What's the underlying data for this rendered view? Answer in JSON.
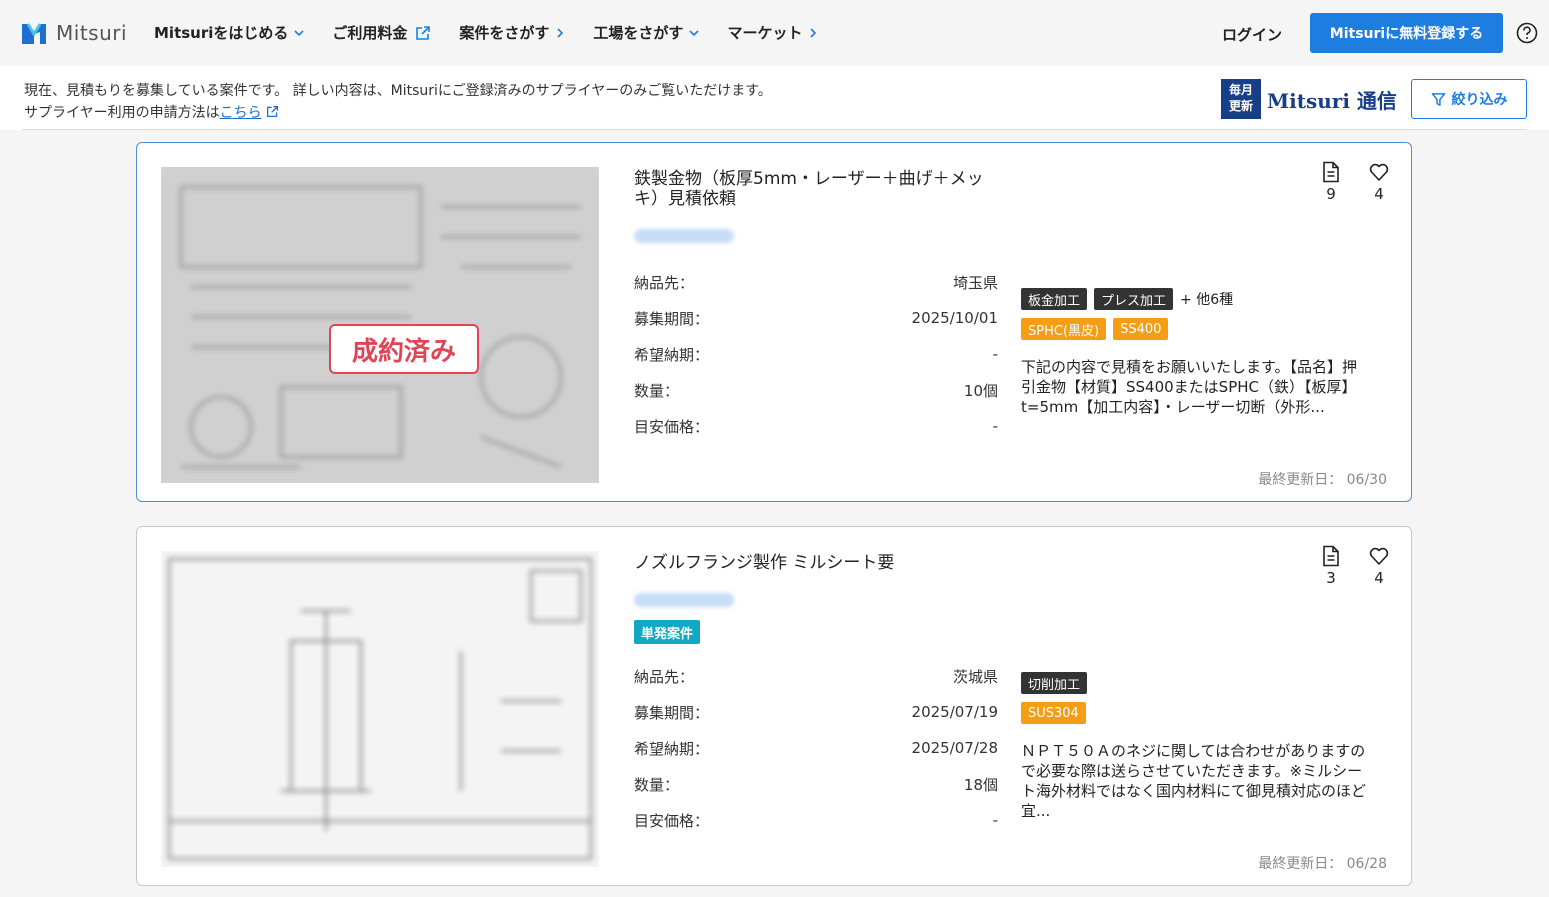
{
  "header": {
    "logo_text": "Mitsuri",
    "nav": [
      {
        "label": "Mitsuriをはじめる",
        "icon": "chevron-down-icon"
      },
      {
        "label": "ご利用料金",
        "icon": "external-link-icon"
      },
      {
        "label": "案件をさがす",
        "icon": "chevron-right-icon"
      },
      {
        "label": "工場をさがす",
        "icon": "chevron-down-icon"
      },
      {
        "label": "マーケット",
        "icon": "chevron-right-icon"
      }
    ],
    "login_label": "ログイン",
    "register_label": "Mitsuriに無料登録する",
    "accent_color": "#1e7ee0"
  },
  "info": {
    "line1": "現在、見積もりを募集している案件です。 詳しい内容は、Mitsuriにご登録済みのサプライヤーのみご覧いただけます。",
    "line2_prefix": "サプライヤー利用の申請方法は",
    "line2_link": "こちら",
    "tsushin_badge_line1": "毎月",
    "tsushin_badge_line2": "更新",
    "tsushin_text": "Mitsuri 通信",
    "filter_label": "絞り込み"
  },
  "cards": [
    {
      "title": "鉄製金物（板厚5mm・レーザー＋曲げ＋メッキ）見積依頼",
      "stamp": "成約済み",
      "specs": [
        {
          "k": "納品先：",
          "v": "埼玉県"
        },
        {
          "k": "募集期間：",
          "v": "2025/10/01"
        },
        {
          "k": "希望納期：",
          "v": "-"
        },
        {
          "k": "数量：",
          "v": "10個"
        },
        {
          "k": "目安価格：",
          "v": "-"
        }
      ],
      "process_tags": [
        "板金加工",
        "プレス加工"
      ],
      "more_tags": "+ 他6種",
      "material_tags": [
        "SPHC(黒皮)",
        "SS400"
      ],
      "description": "下記の内容で見積をお願いいたします。【品名】押引金物【材質】SS400またはSPHC（鉄）【板厚】t=5mm【加工内容】・レーザー切断（外形...",
      "files_count": "9",
      "likes_count": "4",
      "updated": "最終更新日： 06/30"
    },
    {
      "title": "ノズルフランジ製作 ミルシート要",
      "single_tag": "単発案件",
      "specs": [
        {
          "k": "納品先：",
          "v": "茨城県"
        },
        {
          "k": "募集期間：",
          "v": "2025/07/19"
        },
        {
          "k": "希望納期：",
          "v": "2025/07/28"
        },
        {
          "k": "数量：",
          "v": "18個"
        },
        {
          "k": "目安価格：",
          "v": "-"
        }
      ],
      "process_tags": [
        "切削加工"
      ],
      "material_tags": [
        "SUS304"
      ],
      "description": "ＮＰＴ５０Ａのネジに関しては合わせがありますので必要な際は送らさせていただきます。※ミルシート海外材料ではなく国内材料にて御見積対応のほど宜...",
      "files_count": "3",
      "likes_count": "4",
      "updated": "最終更新日： 06/28"
    }
  ]
}
